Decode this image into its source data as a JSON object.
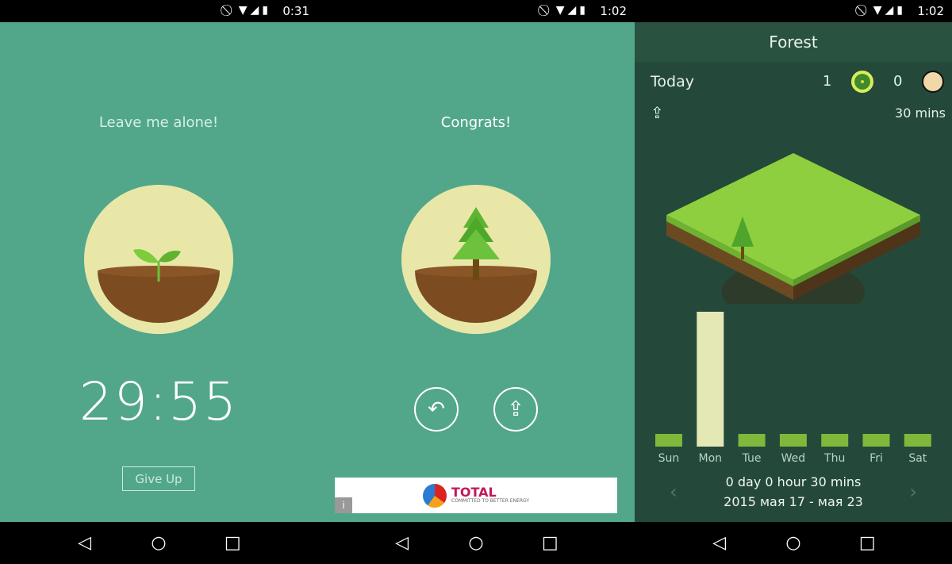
{
  "screens": [
    {
      "status": {
        "time": "0:31",
        "icons": "⃠ ▼◢▮"
      },
      "title": "Leave me alone!",
      "timer": "29:55",
      "give_up": "Give Up"
    },
    {
      "status": {
        "time": "1:02",
        "icons": "⃠ ▼◢▮"
      },
      "title": "Congrats!",
      "ad": {
        "brand": "TOTAL",
        "tagline": "COMMITTED TO BETTER ENERGY",
        "info": "i"
      }
    },
    {
      "status": {
        "time": "1:02",
        "icons": "⃠ ▼◢▮"
      },
      "header": "Forest",
      "today": "Today",
      "healthy_count": "1",
      "withered_count": "0",
      "total_time": "30 mins",
      "summary": "0 day 0 hour 30 mins",
      "range": "2015 мая 17 - мая 23"
    }
  ],
  "nav": {
    "back": "◁",
    "home": "○",
    "recents": "□"
  },
  "chart_data": {
    "type": "bar",
    "categories": [
      "Sun",
      "Mon",
      "Tue",
      "Wed",
      "Thu",
      "Fri",
      "Sat"
    ],
    "values": [
      0,
      30,
      0,
      0,
      0,
      0,
      0
    ],
    "ylabel": "",
    "highlight": "Mon"
  },
  "colors": {
    "bg": "#52a78a",
    "forest_bg": "#24493a",
    "bar": "#7fb83a",
    "bar_highlight": "#e4e8b4"
  }
}
